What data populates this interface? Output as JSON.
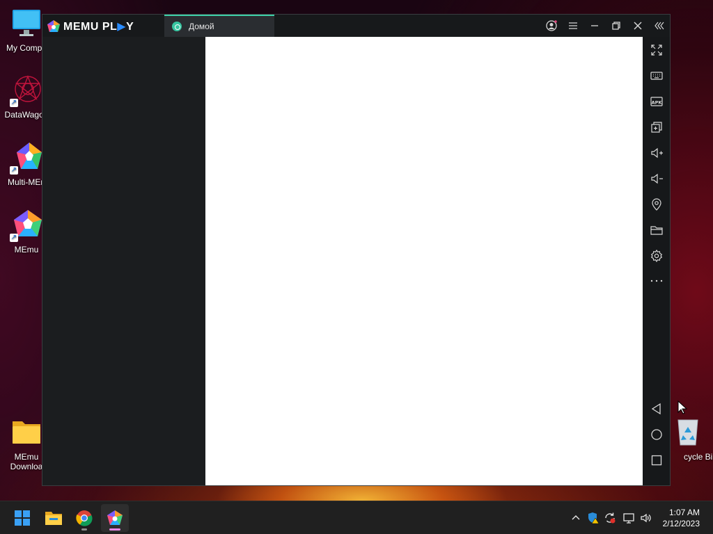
{
  "desktop": {
    "icons": [
      {
        "label": "My Compu",
        "icon": "monitor-icon"
      },
      {
        "label": "DataWagon",
        "icon": "datawagon-icon"
      },
      {
        "label": "Multi-MEn",
        "icon": "multi-memu-icon"
      },
      {
        "label": "MEmu",
        "icon": "memu-icon"
      },
      {
        "label": "MEmu Downloa",
        "icon": "folder-icon"
      },
      {
        "label": "cycle Bin",
        "icon": "recycle-bin-icon"
      }
    ]
  },
  "window": {
    "logo": {
      "part1": "MEMU PL",
      "part2": "▶",
      "part3": "Y"
    },
    "tab": {
      "label": "Домой"
    },
    "controls": [
      "account-icon",
      "menu-icon",
      "minimize-icon",
      "restore-icon",
      "close-icon",
      "collapse-sidebar-icon"
    ]
  },
  "sidebar": {
    "tools": [
      "fullscreen-icon",
      "keyboard-icon",
      "apk-icon",
      "multi-window-icon",
      "volume-up-icon",
      "volume-down-icon",
      "location-icon",
      "folder-icon",
      "settings-icon",
      "more-icon"
    ],
    "apk_label": "APK",
    "nav": [
      "back-icon",
      "home-icon",
      "recents-icon"
    ]
  },
  "taskbar": {
    "apps": [
      "start-icon",
      "file-explorer-icon",
      "chrome-icon",
      "memu-icon"
    ],
    "tray": [
      "chevron-up-icon",
      "security-icon",
      "sync-icon",
      "network-icon",
      "volume-icon"
    ],
    "time": "1:07 AM",
    "date": "2/12/2023"
  },
  "colors": {
    "accent": "#3fd0a8",
    "taskbar": "#202020",
    "window": "#1b1d1f"
  }
}
